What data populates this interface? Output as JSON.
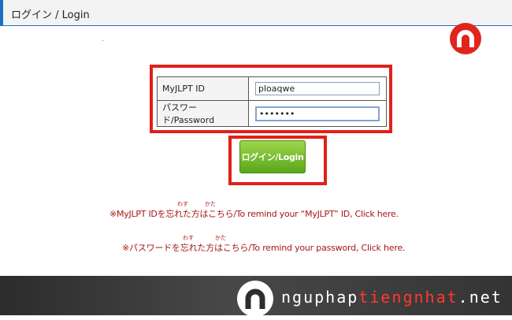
{
  "page": {
    "title": "ログイン / Login"
  },
  "colors": {
    "header_accent": "#1a6fc2",
    "highlight": "#e0211a",
    "button_green": "#6fbc2b",
    "link_text": "#a51616",
    "brand_red": "#e0251b"
  },
  "icons": {
    "brand": "nguphap-logo-icon",
    "footer_brand": "nguphap-logo-icon"
  },
  "form": {
    "id_label": "MyJLPT ID",
    "id_value": "ploaqwe",
    "password_label": "パスワード/Password",
    "password_value": "•••••••"
  },
  "login_button": {
    "label": "ログイン/Login"
  },
  "links": {
    "remind_id": "※MyJLPT IDを忘れた方はこちら/To remind your “MyJLPT” ID, Click here.",
    "remind_id_ruby_1": "わす",
    "remind_id_ruby_2": "かた",
    "remind_password": "※パスワードを忘れた方はこちら/To remind your password, Click here.",
    "remind_password_ruby_1": "わす",
    "remind_password_ruby_2": "かた"
  },
  "footer": {
    "site_part1": "nguphap",
    "site_part2": "tiengnhat",
    "site_part3": ".net"
  }
}
